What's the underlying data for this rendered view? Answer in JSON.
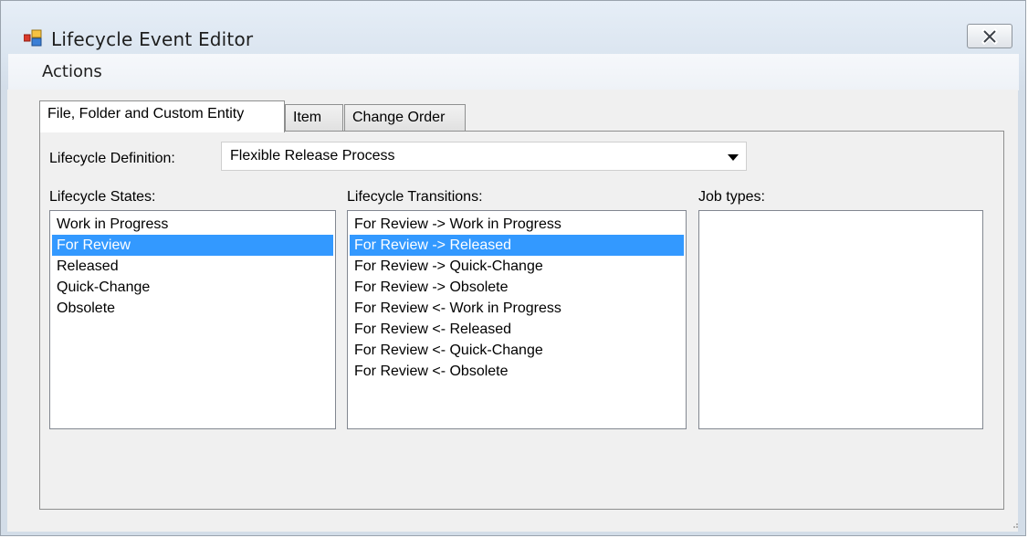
{
  "window": {
    "title": "Lifecycle Event Editor",
    "app_icon": "lifecycle-editor-icon",
    "close_icon": "close-icon"
  },
  "menu": {
    "items": [
      {
        "label": "Actions"
      }
    ]
  },
  "tabs": [
    {
      "label": "File, Folder and Custom Entity",
      "active": true
    },
    {
      "label": "Item",
      "active": false
    },
    {
      "label": "Change Order",
      "active": false
    }
  ],
  "lifecycle_definition": {
    "label": "Lifecycle Definition:",
    "selected": "Flexible Release Process"
  },
  "states": {
    "label": "Lifecycle States:",
    "items": [
      "Work in Progress",
      "For Review",
      "Released",
      "Quick-Change",
      "Obsolete"
    ],
    "selected": "For Review"
  },
  "transitions": {
    "label": "Lifecycle Transitions:",
    "items": [
      "For Review -> Work in Progress",
      "For Review -> Released",
      "For Review -> Quick-Change",
      "For Review -> Obsolete",
      "For Review <- Work in Progress",
      "For Review <- Released",
      "For Review <- Quick-Change",
      "For Review <- Obsolete"
    ],
    "selected": "For Review -> Released"
  },
  "job_types": {
    "label": "Job types:",
    "items": []
  },
  "colors": {
    "selection": "#3399ff",
    "window_chrome": "#dbe5f0",
    "client": "#f0f0f0"
  }
}
